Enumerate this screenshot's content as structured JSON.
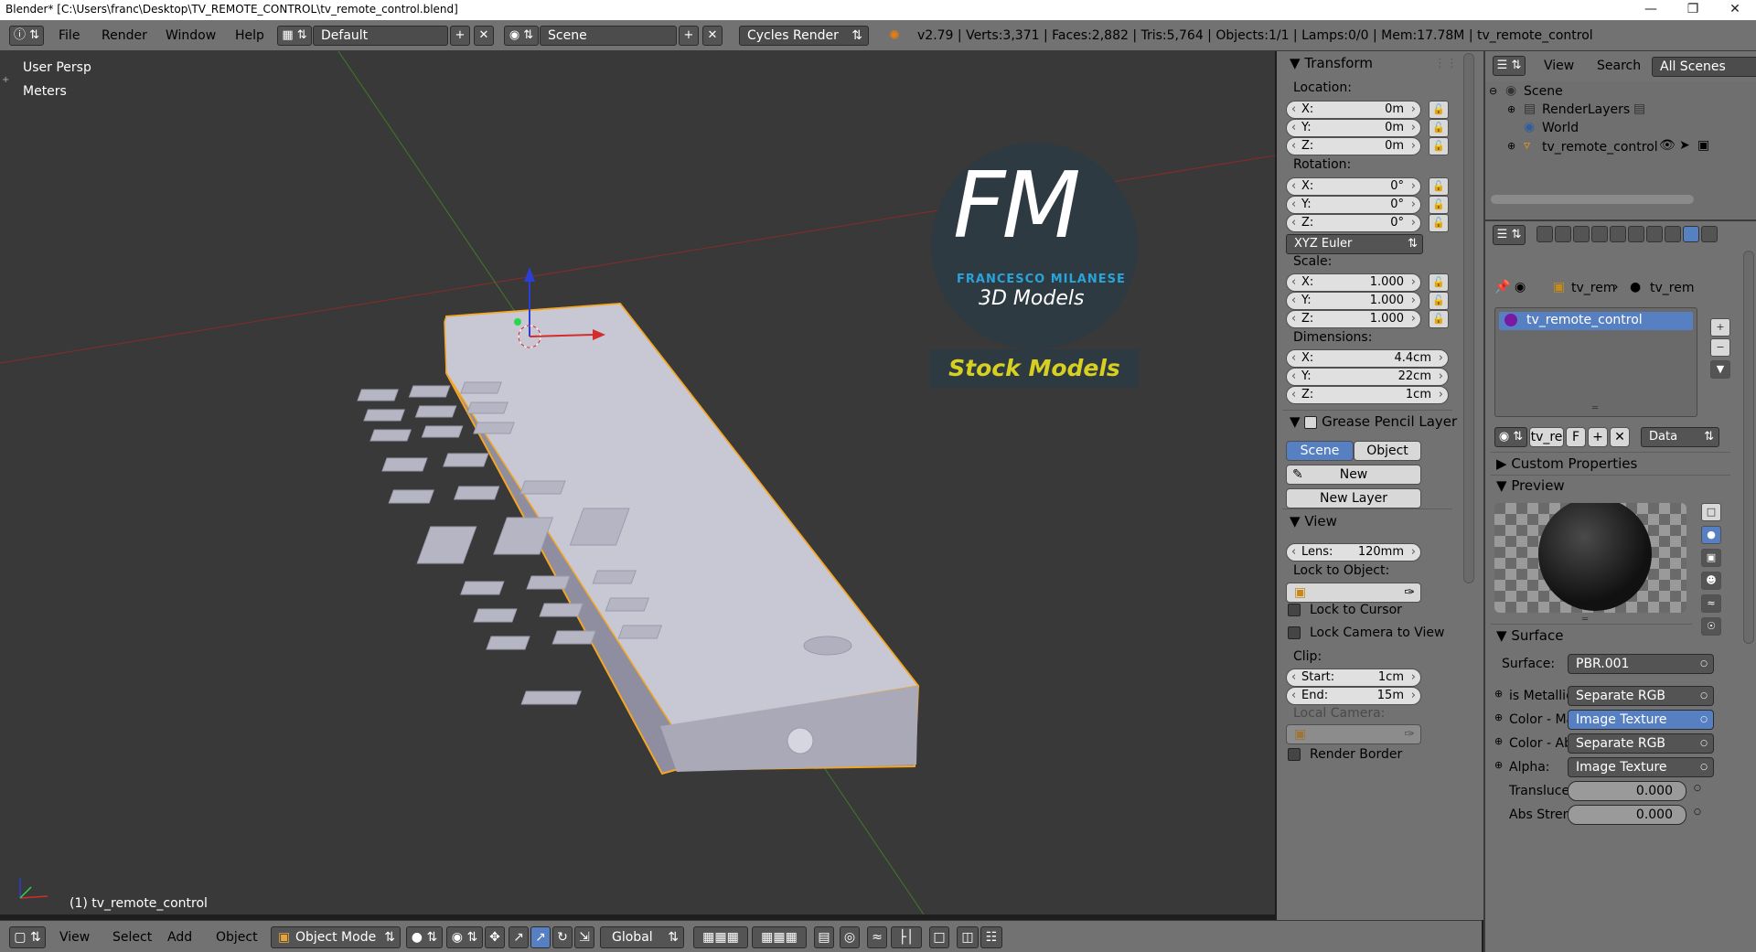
{
  "window": {
    "title": "Blender* [C:\\Users\\franc\\Desktop\\TV_REMOTE_CONTROL\\tv_remote_control.blend]",
    "minimize": "—",
    "maximize": "❐",
    "close": "✕"
  },
  "topbar": {
    "menus": [
      "File",
      "Render",
      "Window",
      "Help"
    ],
    "layout": "Default",
    "scene": "Scene",
    "engine": "Cycles Render",
    "stats": "v2.79 | Verts:3,371 | Faces:2,882 | Tris:5,764 | Objects:1/1 | Lamps:0/0 | Mem:17.78M | tv_remote_control"
  },
  "viewport": {
    "view_name": "User Persp",
    "units": "Meters",
    "object_label": "(1) tv_remote_control",
    "logo": {
      "monogram": "FM",
      "brand": "FRANCESCO MILANESE",
      "tagline": "3D Models",
      "banner": "Stock Models"
    }
  },
  "bottombar": {
    "menus": [
      "View",
      "Select",
      "Add",
      "Object"
    ],
    "mode": "Object Mode",
    "orientation": "Global"
  },
  "npanel": {
    "transform": {
      "header": "Transform",
      "location_label": "Location:",
      "location": [
        {
          "axis": "X:",
          "value": "0m"
        },
        {
          "axis": "Y:",
          "value": "0m"
        },
        {
          "axis": "Z:",
          "value": "0m"
        }
      ],
      "rotation_label": "Rotation:",
      "rotation": [
        {
          "axis": "X:",
          "value": "0°"
        },
        {
          "axis": "Y:",
          "value": "0°"
        },
        {
          "axis": "Z:",
          "value": "0°"
        }
      ],
      "rotation_mode": "XYZ Euler",
      "scale_label": "Scale:",
      "scale": [
        {
          "axis": "X:",
          "value": "1.000"
        },
        {
          "axis": "Y:",
          "value": "1.000"
        },
        {
          "axis": "Z:",
          "value": "1.000"
        }
      ],
      "dimensions_label": "Dimensions:",
      "dimensions": [
        {
          "axis": "X:",
          "value": "4.4cm"
        },
        {
          "axis": "Y:",
          "value": "22cm"
        },
        {
          "axis": "Z:",
          "value": "1cm"
        }
      ]
    },
    "grease_pencil": {
      "header": "Grease Pencil Layer",
      "tab_scene": "Scene",
      "tab_object": "Object",
      "new": "New",
      "new_layer": "New Layer"
    },
    "view": {
      "header": "View",
      "lens_label": "Lens:",
      "lens_value": "120mm",
      "lock_object_label": "Lock to Object:",
      "lock_cursor": "Lock to Cursor",
      "lock_camera": "Lock Camera to View",
      "clip_label": "Clip:",
      "clip_start_label": "Start:",
      "clip_start": "1cm",
      "clip_end_label": "End:",
      "clip_end": "15m",
      "local_camera": "Local Camera:",
      "render_border": "Render Border"
    }
  },
  "outliner": {
    "menu_view": "View",
    "menu_search": "Search",
    "filter": "All Scenes",
    "items": [
      "Scene",
      "RenderLayers",
      "World",
      "tv_remote_control"
    ]
  },
  "properties": {
    "breadcrumb": [
      "tv_rem",
      "tv_rem"
    ],
    "material_slot": "tv_remote_control",
    "material_name": "tv_re",
    "material_fake": "F",
    "link_mode": "Data",
    "custom_properties": "Custom Properties",
    "preview": "Preview",
    "surface_header": "Surface",
    "surface_label": "Surface:",
    "surface_value": "PBR.001",
    "inputs": [
      {
        "label": "is Metallic",
        "value": "Separate RGB",
        "selected": false
      },
      {
        "label": "Color - Ma",
        "value": "Image Texture",
        "selected": true
      },
      {
        "label": "Color - Ab",
        "value": "Separate RGB",
        "selected": false
      },
      {
        "label": "Alpha:",
        "value": "Image Texture",
        "selected": false
      }
    ],
    "sliders": [
      {
        "label": "Transluce",
        "value": "0.000"
      },
      {
        "label": "Abs Stren",
        "value": "0.000"
      }
    ]
  },
  "colors": {
    "selection_outline": "#f5a623",
    "accent_blue": "#5680c2",
    "logo_blue": "#2aa3d8",
    "logo_yellow": "#d8d020"
  }
}
